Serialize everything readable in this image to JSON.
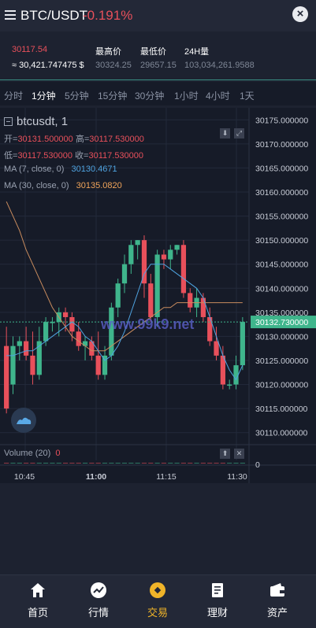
{
  "header": {
    "pair": "BTC/USDT",
    "change": "-0.191%",
    "close_icon": "close-circle-icon"
  },
  "stats": {
    "price": "30117.54",
    "cny": "≈ 30,421.747475 $",
    "high_label": "最高价",
    "high_value": "30324.25",
    "low_label": "最低价",
    "low_value": "29657.15",
    "vol_label": "24H量",
    "vol_value": "103,034,261.9588"
  },
  "tabs": [
    {
      "label": "分时",
      "active": false
    },
    {
      "label": "1分钟",
      "active": true
    },
    {
      "label": "5分钟",
      "active": false
    },
    {
      "label": "15分钟",
      "active": false
    },
    {
      "label": "30分钟",
      "active": false
    },
    {
      "label": "1小时",
      "active": false
    },
    {
      "label": "4小时",
      "active": false
    },
    {
      "label": "1天",
      "active": false
    }
  ],
  "chart": {
    "symbol": "btcusdt, 1",
    "open_label": "开=",
    "open": "30131.500000",
    "high_label": "高=",
    "high": "30117.530000",
    "low_label": "低=",
    "low": "30117.530000",
    "close_label": "收=",
    "close": "30117.530000",
    "ma7_label": "MA (7, close, 0)",
    "ma7_value": "30130.4671",
    "ma30_label": "MA (30, close, 0)",
    "ma30_value": "30135.0820",
    "watermark": "www.99k9.net",
    "volume_label": "Volume (20)",
    "volume_value": "0",
    "current_price_tag": "30132.730000",
    "volume_axis_label": "0",
    "colors": {
      "up": "#3fb58c",
      "down": "#e8505b",
      "ma7": "#4fa3e0",
      "ma30": "#c98c5e"
    }
  },
  "chart_data": {
    "type": "candlestick",
    "y_ticks": [
      "30175.000000",
      "30170.000000",
      "30165.000000",
      "30160.000000",
      "30155.000000",
      "30150.000000",
      "30145.000000",
      "30140.000000",
      "30135.000000",
      "30130.000000",
      "30125.000000",
      "30120.000000",
      "30115.000000",
      "30110.000000"
    ],
    "ylim": [
      30107.5,
      30177.5
    ],
    "x_ticks": [
      {
        "label": "10:45",
        "bold": false
      },
      {
        "label": "11:00",
        "bold": true
      },
      {
        "label": "11:15",
        "bold": false
      },
      {
        "label": "11:30",
        "bold": false
      }
    ],
    "candles": [
      {
        "o": 30128,
        "h": 30132,
        "l": 30114,
        "c": 30115
      },
      {
        "o": 30120,
        "h": 30130,
        "l": 30118,
        "c": 30128
      },
      {
        "o": 30128,
        "h": 30130,
        "l": 30125,
        "c": 30129
      },
      {
        "o": 30129,
        "h": 30132,
        "l": 30125,
        "c": 30126
      },
      {
        "o": 30126,
        "h": 30131,
        "l": 30120,
        "c": 30122
      },
      {
        "o": 30122,
        "h": 30132,
        "l": 30121,
        "c": 30129
      },
      {
        "o": 30129,
        "h": 30134,
        "l": 30128,
        "c": 30133
      },
      {
        "o": 30133,
        "h": 30134,
        "l": 30131,
        "c": 30133
      },
      {
        "o": 30133,
        "h": 30136,
        "l": 30130,
        "c": 30135
      },
      {
        "o": 30135,
        "h": 30136,
        "l": 30131,
        "c": 30134
      },
      {
        "o": 30134,
        "h": 30135,
        "l": 30129,
        "c": 30131
      },
      {
        "o": 30131,
        "h": 30133,
        "l": 30127,
        "c": 30128
      },
      {
        "o": 30128,
        "h": 30130,
        "l": 30125,
        "c": 30129
      },
      {
        "o": 30129,
        "h": 30130,
        "l": 30125,
        "c": 30126
      },
      {
        "o": 30126,
        "h": 30131,
        "l": 30121,
        "c": 30122
      },
      {
        "o": 30122,
        "h": 30128,
        "l": 30121,
        "c": 30126
      },
      {
        "o": 30126,
        "h": 30137,
        "l": 30125,
        "c": 30136
      },
      {
        "o": 30136,
        "h": 30142,
        "l": 30134,
        "c": 30141
      },
      {
        "o": 30141,
        "h": 30147,
        "l": 30139,
        "c": 30145
      },
      {
        "o": 30145,
        "h": 30150,
        "l": 30143,
        "c": 30149
      },
      {
        "o": 30149,
        "h": 30150,
        "l": 30146,
        "c": 30150
      },
      {
        "o": 30150,
        "h": 30151,
        "l": 30138,
        "c": 30141
      },
      {
        "o": 30141,
        "h": 30143,
        "l": 30133,
        "c": 30134
      },
      {
        "o": 30134,
        "h": 30148,
        "l": 30132,
        "c": 30147
      },
      {
        "o": 30147,
        "h": 30148,
        "l": 30144,
        "c": 30146
      },
      {
        "o": 30146,
        "h": 30149,
        "l": 30144,
        "c": 30148
      },
      {
        "o": 30148,
        "h": 30149,
        "l": 30147,
        "c": 30149
      },
      {
        "o": 30149,
        "h": 30150,
        "l": 30138,
        "c": 30139
      },
      {
        "o": 30139,
        "h": 30140,
        "l": 30135,
        "c": 30136
      },
      {
        "o": 30136,
        "h": 30140,
        "l": 30134,
        "c": 30138
      },
      {
        "o": 30138,
        "h": 30139,
        "l": 30133,
        "c": 30134
      },
      {
        "o": 30134,
        "h": 30136,
        "l": 30128,
        "c": 30129
      },
      {
        "o": 30129,
        "h": 30132,
        "l": 30125,
        "c": 30126
      },
      {
        "o": 30126,
        "h": 30128,
        "l": 30119,
        "c": 30120
      },
      {
        "o": 30120,
        "h": 30121,
        "l": 30119,
        "c": 30120
      },
      {
        "o": 30120,
        "h": 30126,
        "l": 30119,
        "c": 30124
      },
      {
        "o": 30124,
        "h": 30134,
        "l": 30123,
        "c": 30133
      }
    ],
    "ma7": [
      30126,
      30126,
      30126.5,
      30127,
      30127,
      30128,
      30129,
      30130,
      30131,
      30132,
      30133,
      30132,
      30130,
      30129,
      30127,
      30125,
      30126,
      30128,
      30131,
      30135,
      30139,
      30143,
      30145,
      30145,
      30145,
      30144,
      30143,
      30142,
      30141,
      30140,
      30138,
      30134,
      30130,
      30126,
      30123,
      30121,
      30124
    ],
    "ma30": [
      30158,
      30155,
      30152,
      30148,
      30145,
      30142,
      30139,
      30136,
      30134,
      30132,
      30130,
      30129,
      30128,
      30127,
      30127,
      30127,
      30128,
      30129,
      30130,
      30131,
      30132,
      30133,
      30134,
      30135,
      30136,
      30136,
      30137,
      30137,
      30137,
      30137,
      30137,
      30137,
      30137,
      30137,
      30137,
      30137,
      30137
    ],
    "volume": [
      0,
      0,
      0,
      0,
      0,
      0,
      0,
      0,
      0,
      0,
      0,
      0,
      0,
      0,
      0,
      0,
      0,
      0,
      0,
      0,
      0,
      0,
      0,
      0,
      0,
      0,
      0,
      0,
      0,
      0,
      0,
      0,
      0,
      0,
      0,
      0,
      0
    ]
  },
  "nav": [
    {
      "label": "首页",
      "icon": "home-icon",
      "active": false
    },
    {
      "label": "行情",
      "icon": "chart-icon",
      "active": false
    },
    {
      "label": "交易",
      "icon": "trade-icon",
      "active": true
    },
    {
      "label": "理财",
      "icon": "document-icon",
      "active": false
    },
    {
      "label": "资产",
      "icon": "wallet-icon",
      "active": false
    }
  ]
}
